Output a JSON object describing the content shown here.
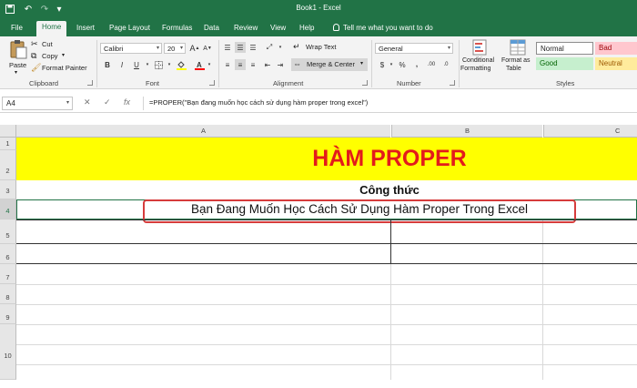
{
  "window": {
    "title": "Book1  -  Excel"
  },
  "quick_access": {
    "icons": [
      "save-icon",
      "undo-icon",
      "redo-icon",
      "customize-icon"
    ]
  },
  "tabs": [
    "File",
    "Home",
    "Insert",
    "Page Layout",
    "Formulas",
    "Data",
    "Review",
    "View",
    "Help"
  ],
  "active_tab": "Home",
  "tell_me": "Tell me what you want to do",
  "ribbon": {
    "clipboard": {
      "paste": "Paste",
      "cut": "Cut",
      "copy": "Copy",
      "format_painter": "Format Painter",
      "label": "Clipboard"
    },
    "font": {
      "name": "Calibri",
      "size": "20",
      "bold": "B",
      "italic": "I",
      "underline": "U",
      "label": "Font"
    },
    "alignment": {
      "wrap": "Wrap Text",
      "merge": "Merge & Center",
      "label": "Alignment"
    },
    "number": {
      "format": "General",
      "currency": "$",
      "percent": "%",
      "comma": ",",
      "label": "Number"
    },
    "styles": {
      "conditional": "Conditional",
      "conditional2": "Formatting",
      "format_as": "Format as",
      "table": "Table",
      "normal": "Normal",
      "bad": "Bad",
      "good": "Good",
      "neutral": "Neutral",
      "label": "Styles",
      "colors": {
        "bad_bg": "#ffc7ce",
        "bad_fg": "#9c0006",
        "good_bg": "#c6efce",
        "good_fg": "#006100",
        "neutral_bg": "#ffeb9c",
        "neutral_fg": "#9c5700"
      }
    }
  },
  "formula_bar": {
    "name_box": "A4",
    "fx": "fx",
    "formula": "=PROPER(\"Bạn đang muốn học cách sử dụng hàm proper trong excel\")"
  },
  "columns": [
    "A",
    "B",
    "C"
  ],
  "rows": [
    "1",
    "2",
    "3",
    "4",
    "5",
    "6",
    "7",
    "8",
    "9",
    "10"
  ],
  "cells": {
    "title": "HÀM PROPER",
    "subtitle": "Công thức",
    "result": "Bạn Đang Muốn Học Cách Sử Dụng Hàm Proper Trong Excel"
  },
  "colors": {
    "brand": "#217346",
    "title_red": "#e31b1b",
    "highlight": "#ffff00",
    "callout": "#d63c3c"
  }
}
